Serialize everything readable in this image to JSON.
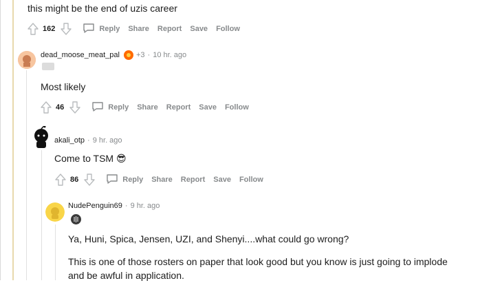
{
  "top_comment": {
    "text": "this might be the end of uzis career",
    "score": "162"
  },
  "actions": {
    "reply": "Reply",
    "share": "Share",
    "report": "Report",
    "save": "Save",
    "follow": "Follow"
  },
  "comments": [
    {
      "username": "dead_moose_meat_pal",
      "award_count": "+3",
      "time": "10 hr. ago",
      "text": "Most likely",
      "score": "46"
    },
    {
      "username": "akali_otp",
      "time": "9 hr. ago",
      "text": "Come to TSM 😎",
      "score": "86"
    },
    {
      "username": "NudePenguin69",
      "time": "9 hr. ago",
      "text_lines": [
        "Ya, Huni, Spica, Jensen, UZI, and Shenyi....what could go wrong?",
        "This is one of those rosters on paper that look good but you know is just going to implode",
        "and be awful in application."
      ]
    }
  ],
  "icons": {
    "upvote": "upvote-arrow-icon",
    "downvote": "downvote-arrow-icon",
    "reply": "comment-bubble-icon",
    "award": "award-icon",
    "flair": "flair-icon"
  },
  "colors": {
    "rail": "#e8d9ac",
    "muted": "#878a8c",
    "text": "#1c1c1c"
  }
}
